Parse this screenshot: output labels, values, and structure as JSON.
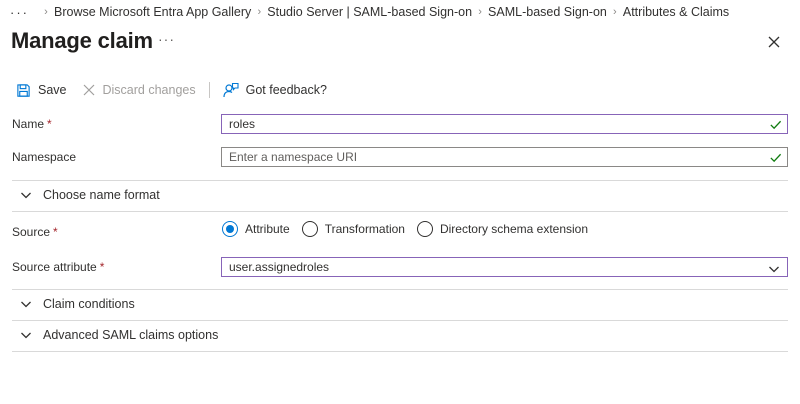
{
  "breadcrumb": {
    "ellipsis": "···",
    "items": [
      "Browse Microsoft Entra App Gallery",
      "Studio Server | SAML-based Sign-on",
      "SAML-based Sign-on",
      "Attributes & Claims"
    ]
  },
  "header": {
    "title": "Manage claim",
    "more": "···"
  },
  "toolbar": {
    "save_label": "Save",
    "discard_label": "Discard changes",
    "feedback_label": "Got feedback?"
  },
  "form": {
    "required_marker": "*",
    "name": {
      "label": "Name",
      "value": "roles"
    },
    "namespace": {
      "label": "Namespace",
      "placeholder": "Enter a namespace URI",
      "value": ""
    },
    "choose_name_format": "Choose name format",
    "source": {
      "label": "Source",
      "options": [
        "Attribute",
        "Transformation",
        "Directory schema extension"
      ],
      "selected": "Attribute"
    },
    "source_attribute": {
      "label": "Source attribute",
      "value": "user.assignedroles"
    },
    "claim_conditions": "Claim conditions",
    "advanced_options": "Advanced SAML claims options"
  },
  "colors": {
    "accent": "#0078d4",
    "focus_border": "#8764b8",
    "valid_check": "#107c10",
    "required": "#a4262c"
  },
  "icons": {
    "close": "close-icon",
    "save": "save-icon",
    "discard": "discard-x-icon",
    "feedback": "feedback-person-icon",
    "valid": "checkmark-icon",
    "expand": "chevron-down-icon"
  }
}
